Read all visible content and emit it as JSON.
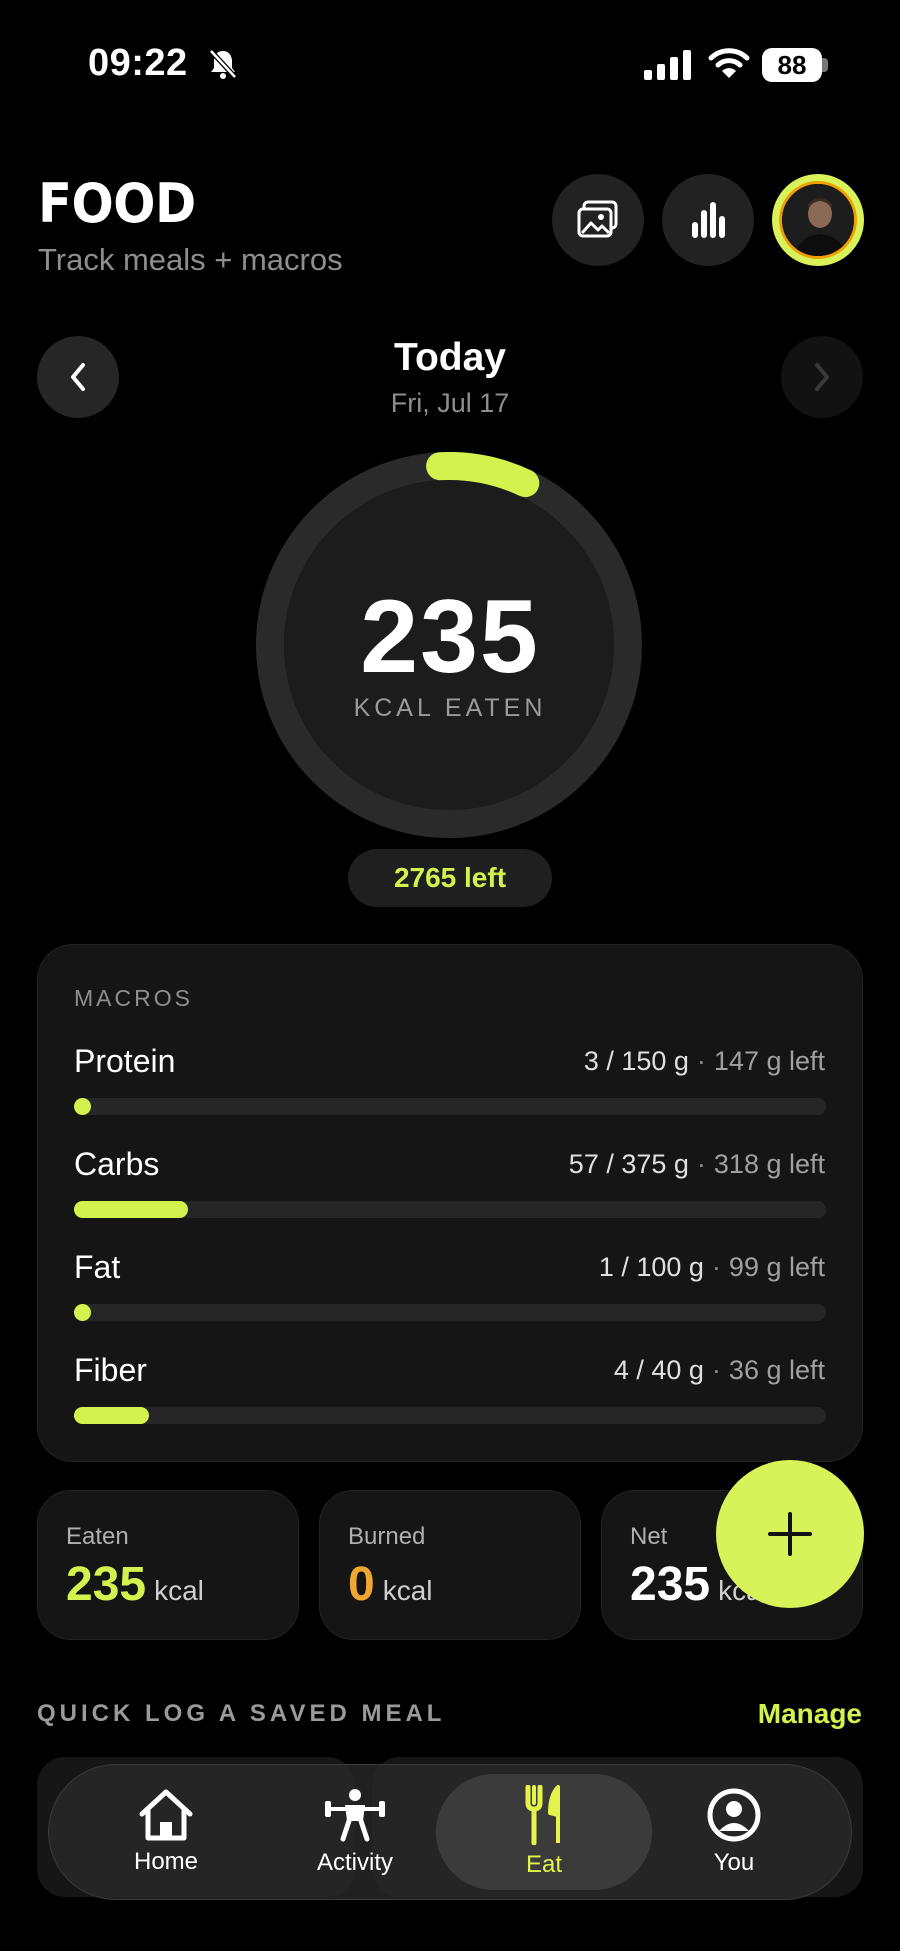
{
  "status": {
    "time": "09:22",
    "battery": "88"
  },
  "header": {
    "title": "FOOD",
    "subtitle": "Track meals + macros"
  },
  "date": {
    "title": "Today",
    "subtitle": "Fri, Jul 17"
  },
  "ring": {
    "value": "235",
    "label": "KCAL EATEN",
    "left": "2765 left",
    "progress": 0.078
  },
  "macros": {
    "heading": "MACROS",
    "items": [
      {
        "name": "Protein",
        "amount": "3 / 150 g",
        "left": "147 g left",
        "progress": 0.02
      },
      {
        "name": "Carbs",
        "amount": "57 / 375 g",
        "left": "318 g left",
        "progress": 0.152
      },
      {
        "name": "Fat",
        "amount": "1 / 100 g",
        "left": "99 g left",
        "progress": 0.01
      },
      {
        "name": "Fiber",
        "amount": "4 / 40 g",
        "left": "36 g left",
        "progress": 0.1
      }
    ]
  },
  "stats": {
    "eaten": {
      "label": "Eaten",
      "value": "235",
      "unit": "kcal"
    },
    "burned": {
      "label": "Burned",
      "value": "0",
      "unit": "kcal"
    },
    "net": {
      "label": "Net",
      "value": "235",
      "unit": "kcal"
    }
  },
  "quicklog": {
    "heading": "QUICK LOG A SAVED MEAL",
    "manage": "Manage"
  },
  "tabs": [
    {
      "label": "Home",
      "icon": "home-icon"
    },
    {
      "label": "Activity",
      "icon": "activity-icon"
    },
    {
      "label": "Eat",
      "icon": "fork-knife-icon",
      "active": true
    },
    {
      "label": "You",
      "icon": "profile-icon"
    }
  ],
  "colors": {
    "accent": "#d4f24d",
    "burned": "#f0a732",
    "background": "#000000",
    "card": "#151515"
  }
}
